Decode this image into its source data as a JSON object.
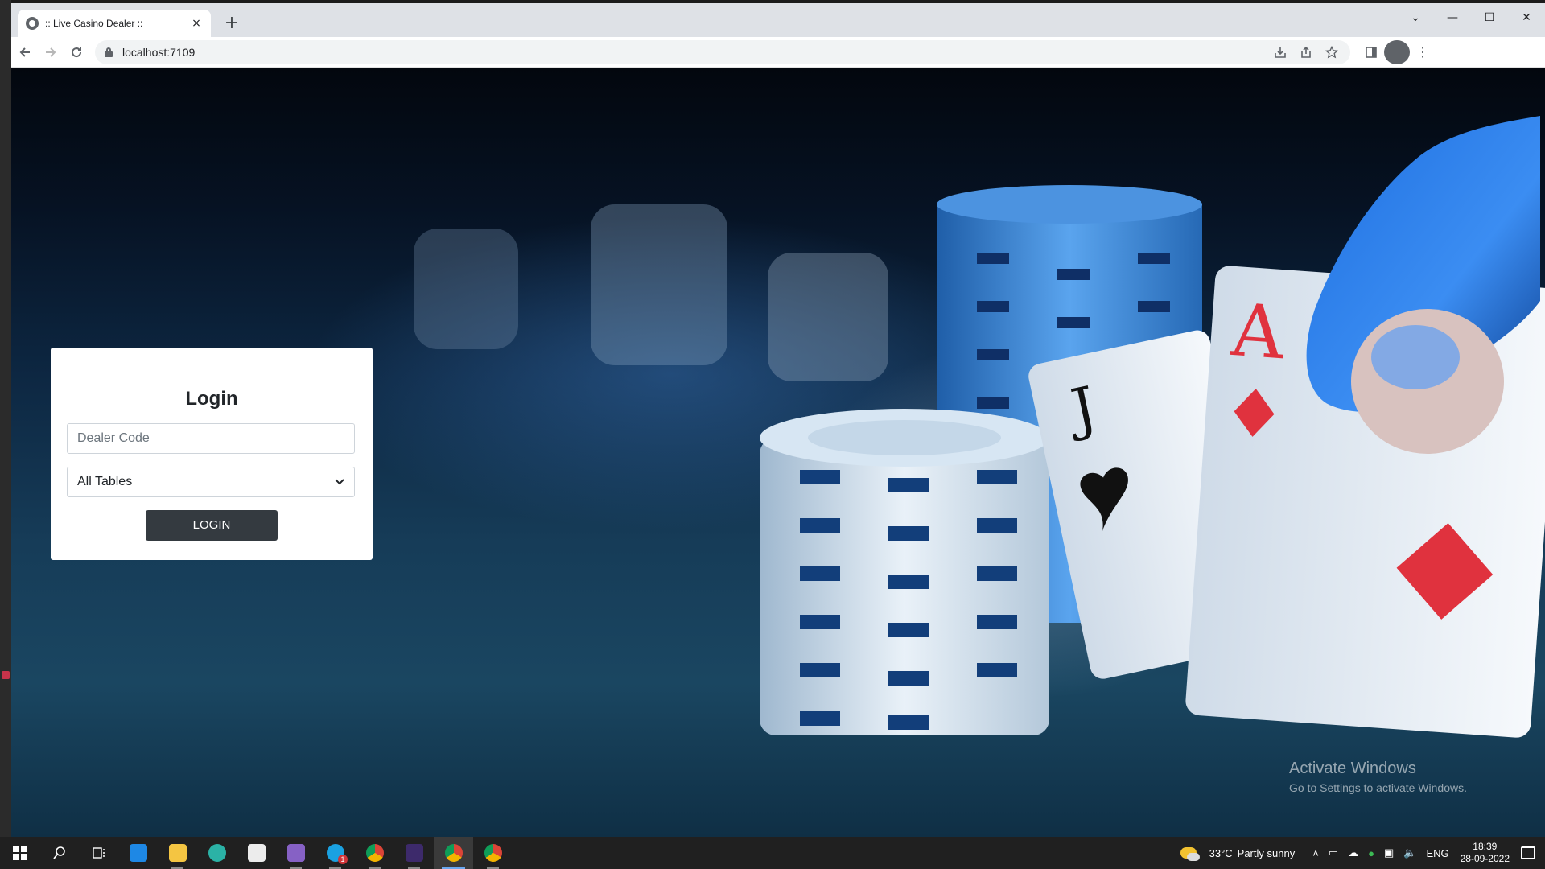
{
  "browser": {
    "tab_title": ":: Live Casino Dealer ::",
    "tab_close": "×",
    "new_tab": "+",
    "url": "localhost:7109",
    "window_controls": {
      "chevron": "⌄",
      "minimize": "—",
      "maximize": "☐",
      "close": "✕"
    }
  },
  "login": {
    "title": "Login",
    "dealer_code_placeholder": "Dealer Code",
    "table_select_value": "All Tables",
    "button_label": "LOGIN"
  },
  "watermark": {
    "line1": "Activate Windows",
    "line2": "Go to Settings to activate Windows."
  },
  "taskbar": {
    "weather_temp": "33°C",
    "weather_text": "Partly sunny",
    "language": "ENG",
    "time": "18:39",
    "date": "28-09-2022",
    "skype_badge": "1"
  },
  "icons": {
    "back": "arrow-left-icon",
    "forward": "arrow-right-icon",
    "reload": "reload-icon",
    "lock": "lock-icon",
    "install": "install-icon",
    "share": "share-icon",
    "bookmark": "star-icon",
    "sidepanel": "side-panel-icon",
    "profile": "avatar-icon",
    "menu": "kebab-menu-icon"
  },
  "colors": {
    "button_bg": "#343a40",
    "tab_strip": "#dee1e6",
    "taskbar": "#202020"
  }
}
